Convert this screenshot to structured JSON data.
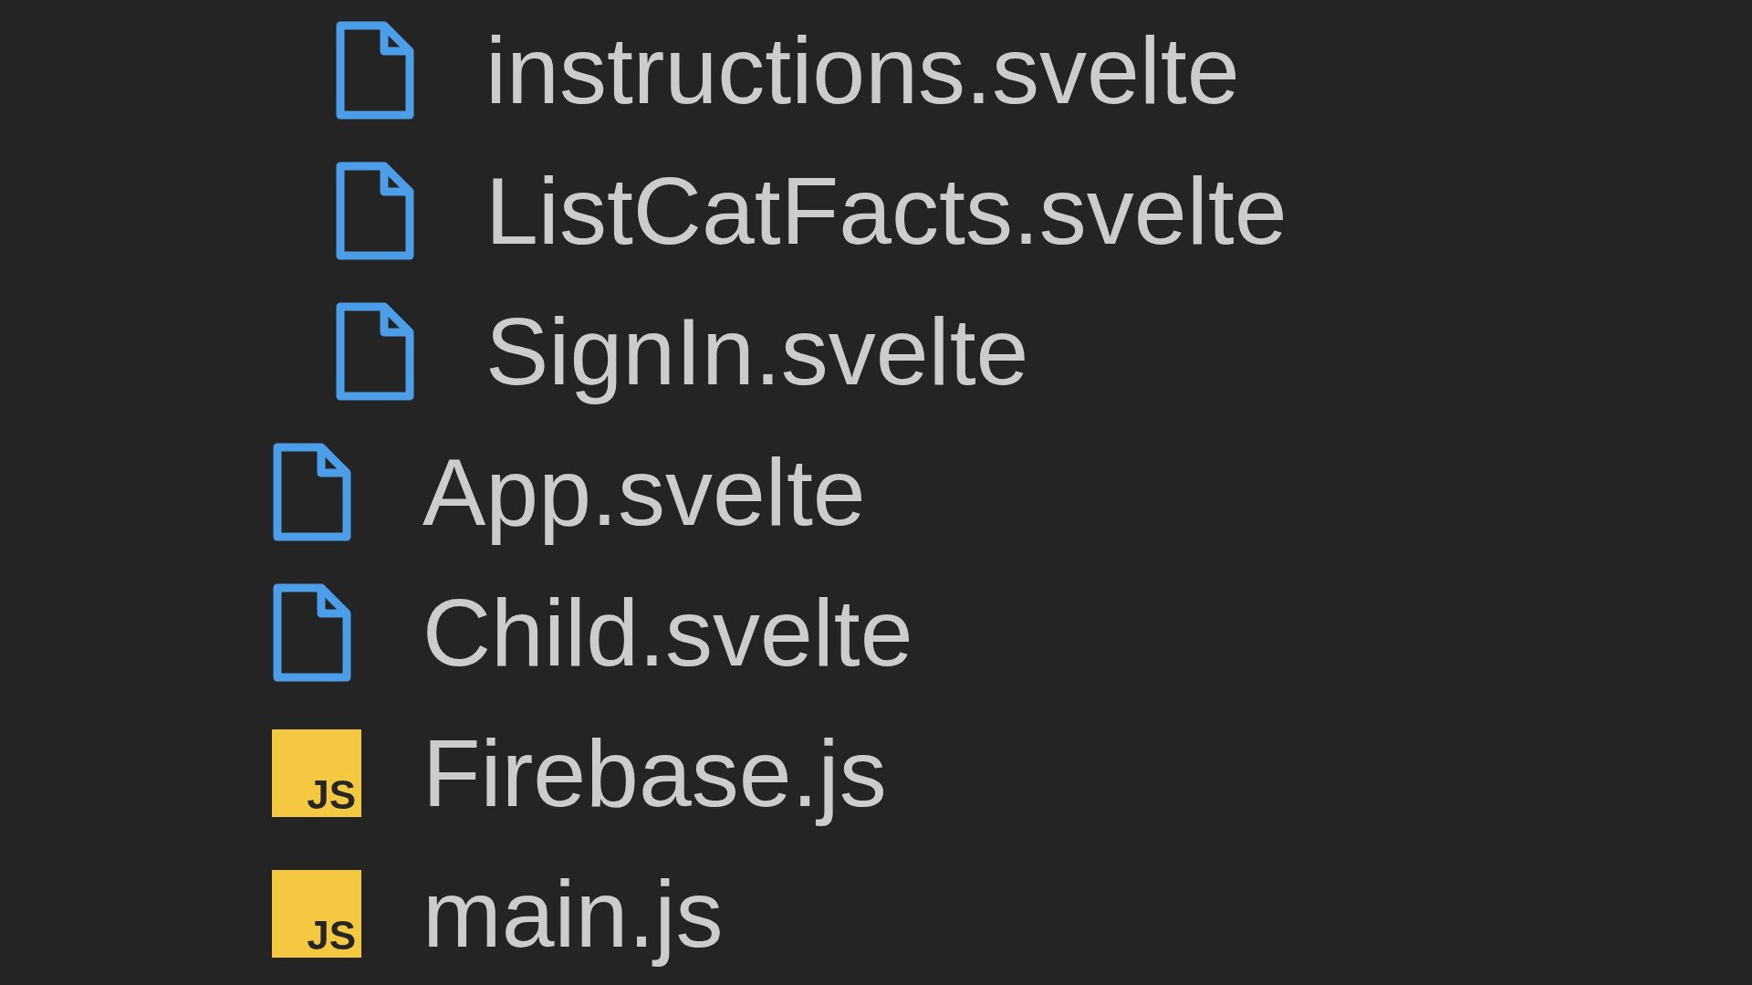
{
  "explorer": {
    "subfolder_files": [
      {
        "name": "instructions.svelte",
        "kind": "svelte"
      },
      {
        "name": "ListCatFacts.svelte",
        "kind": "svelte"
      },
      {
        "name": "SignIn.svelte",
        "kind": "svelte"
      }
    ],
    "files": [
      {
        "name": "App.svelte",
        "kind": "svelte"
      },
      {
        "name": "Child.svelte",
        "kind": "svelte"
      },
      {
        "name": "Firebase.js",
        "kind": "js",
        "badge": "JS"
      },
      {
        "name": "main.js",
        "kind": "js",
        "badge": "JS"
      }
    ]
  }
}
